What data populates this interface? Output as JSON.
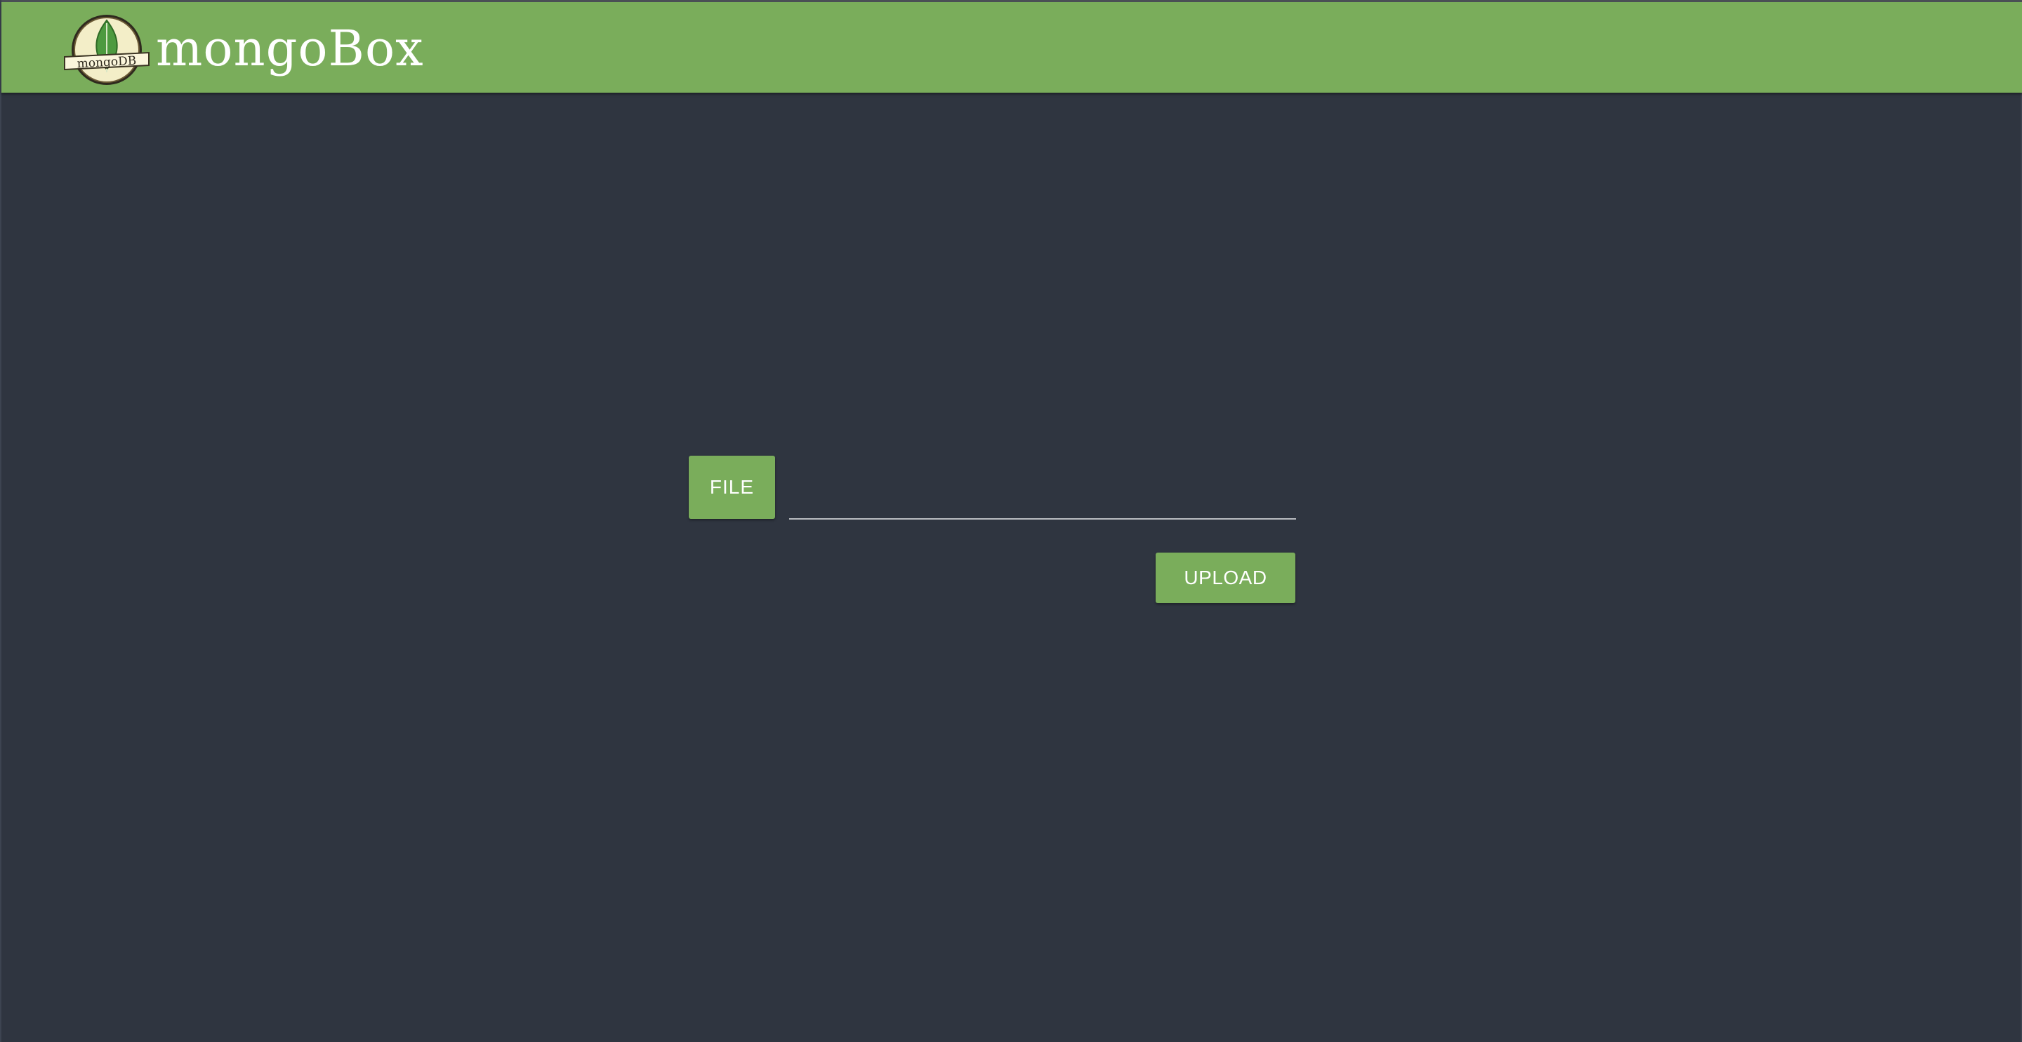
{
  "header": {
    "logo_icon": "mongodb-leaf-logo-icon",
    "logo_text": "mongoDB",
    "brand_name": "mongoBox"
  },
  "upload_form": {
    "file_button_label": "FILE",
    "file_input_value": "",
    "upload_button_label": "UPLOAD"
  },
  "colors": {
    "header_background": "#7aad5b",
    "page_background": "#2f3540",
    "button_background": "#7aad5b",
    "text_on_accent": "#ffffff"
  }
}
